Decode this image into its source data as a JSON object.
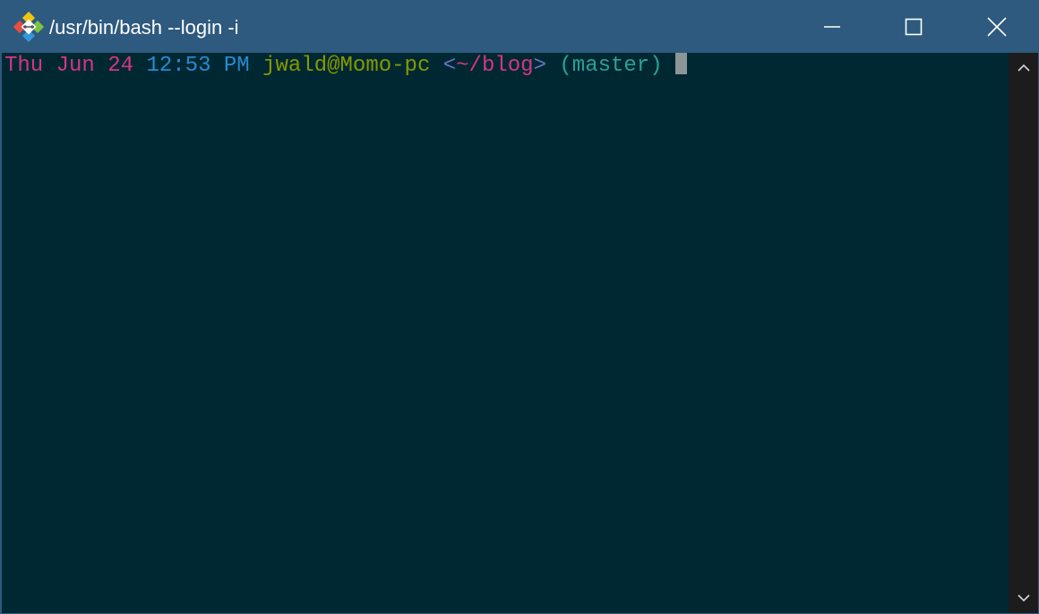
{
  "window": {
    "title": "/usr/bin/bash --login -i",
    "app_icon": "git-bash-icon",
    "controls": {
      "minimize_icon": "minimize-icon",
      "maximize_icon": "maximize-icon",
      "close_icon": "close-icon"
    }
  },
  "terminal": {
    "background_color": "#002833",
    "prompt": {
      "day": "Thu",
      "month": "Jun",
      "date": "24",
      "time": "12:53",
      "ampm": "PM",
      "user_host": "jwald@Momo-pc",
      "cwd_open": "<",
      "cwd": "~/blog",
      "cwd_close": ">",
      "branch": "(master)"
    },
    "colors": {
      "date": "#d33682",
      "time": "#268bd2",
      "user_host": "#859900",
      "cwd_bracket": "#6c71c4",
      "cwd": "#d33682",
      "branch": "#2aa198",
      "cursor": "#8c9698"
    }
  },
  "scrollbar": {
    "up_icon": "chevron-up-icon",
    "down_icon": "chevron-down-icon"
  }
}
